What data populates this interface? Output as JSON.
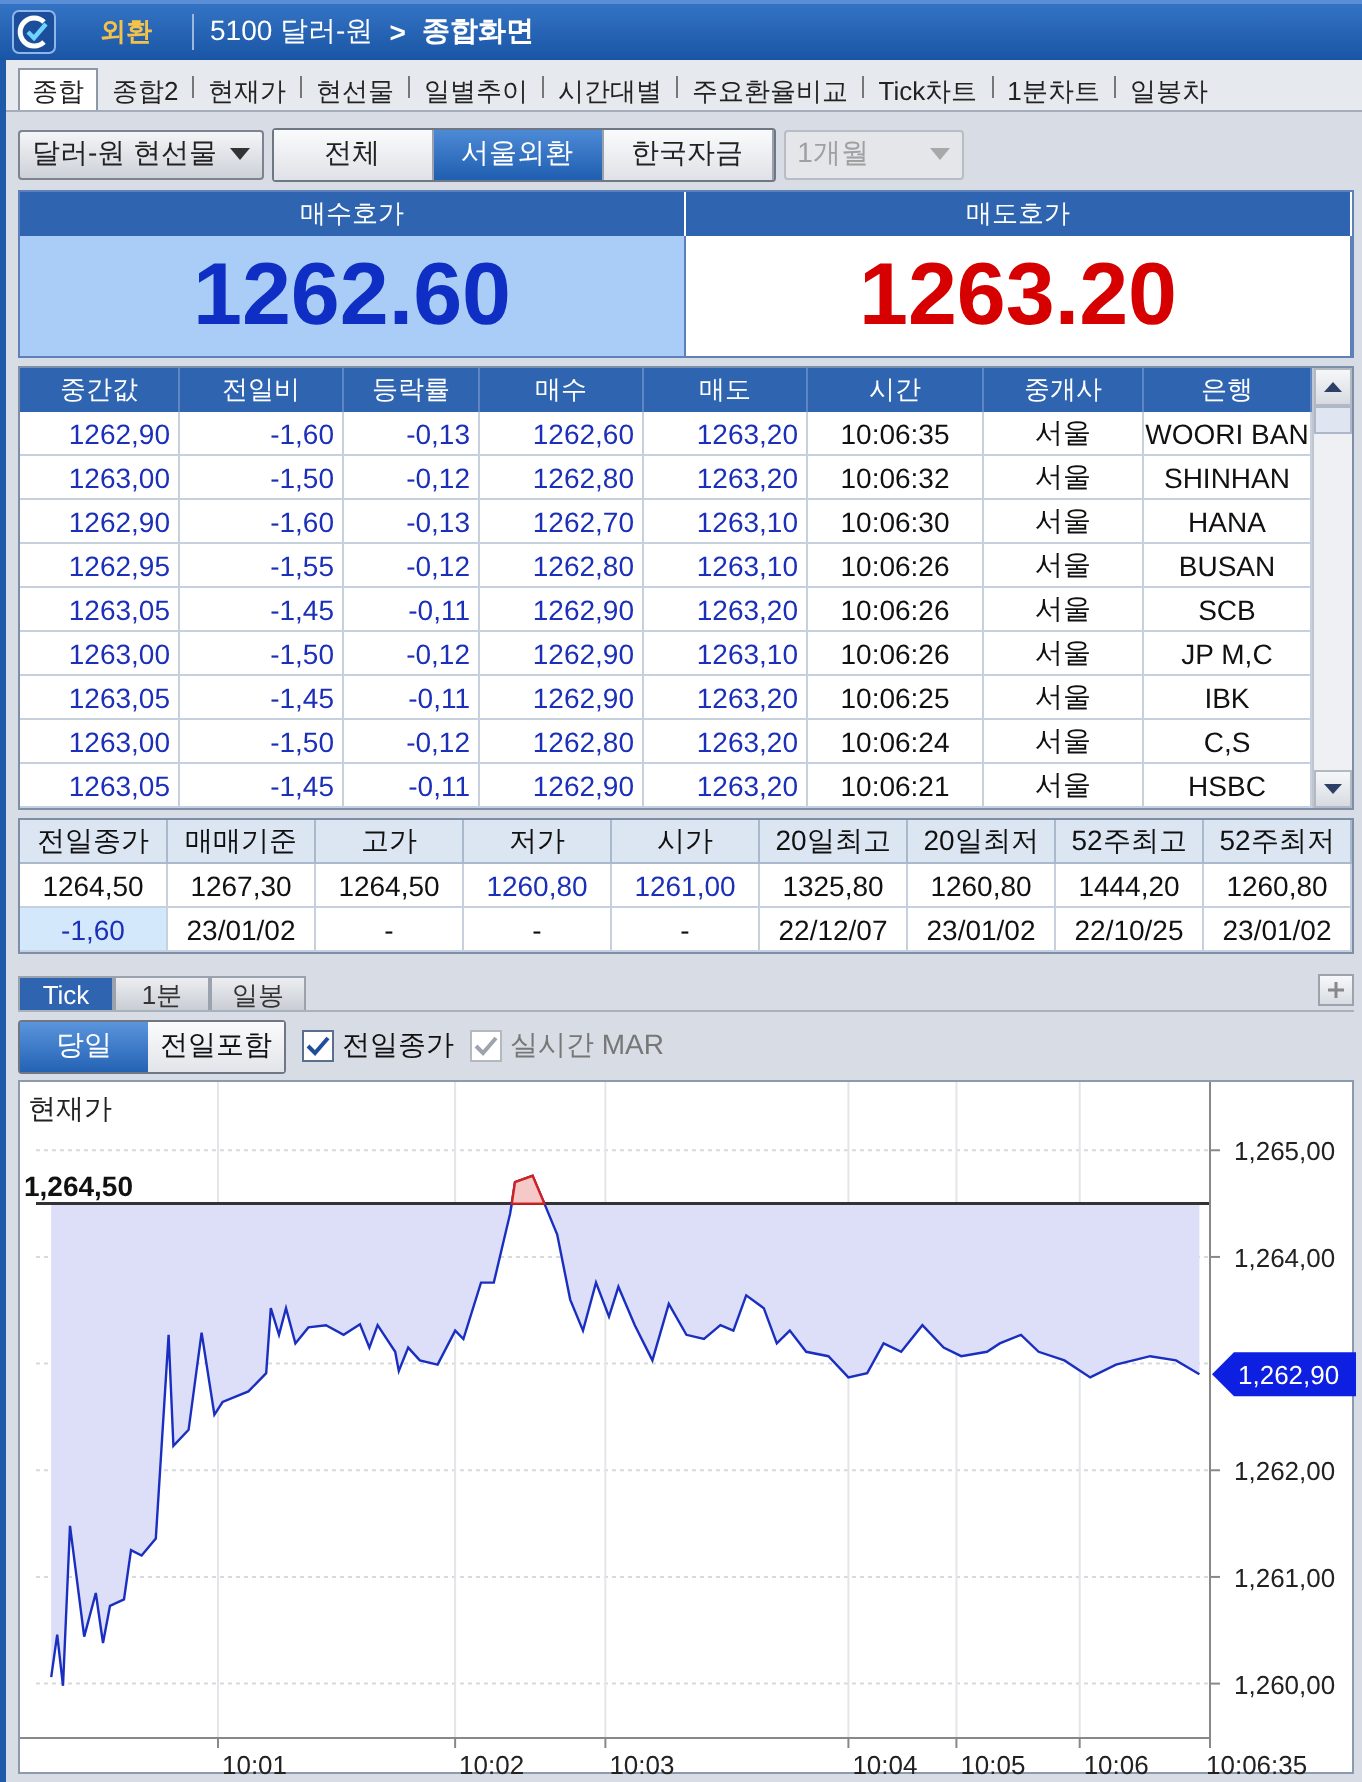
{
  "title_bar": {
    "badge": "외환",
    "screen_code": "5100 달러-원",
    "separator": ">",
    "title": "종합화면"
  },
  "tabs": [
    {
      "label": "종합",
      "selected": true
    },
    {
      "label": "종합2",
      "selected": false
    },
    {
      "label": "현재가",
      "selected": false
    },
    {
      "label": "현선물",
      "selected": false
    },
    {
      "label": "일별추이",
      "selected": false
    },
    {
      "label": "시간대별",
      "selected": false
    },
    {
      "label": "주요환율비교",
      "selected": false
    },
    {
      "label": "Tick차트",
      "selected": false
    },
    {
      "label": "1분차트",
      "selected": false
    },
    {
      "label": "일봉차",
      "selected": false
    }
  ],
  "toolbar": {
    "instrument": "달러-원 현선물",
    "segments": [
      {
        "label": "전체",
        "selected": false
      },
      {
        "label": "서울외환",
        "selected": true
      },
      {
        "label": "한국자금",
        "selected": false
      }
    ],
    "period": {
      "value": "1개월",
      "disabled": true
    }
  },
  "quotes": [
    {
      "label": "매수호가",
      "value": "1262.60"
    },
    {
      "label": "매도호가",
      "value": "1263.20"
    }
  ],
  "trades": {
    "columns": [
      {
        "label": "중간값",
        "kind": "num"
      },
      {
        "label": "전일비",
        "kind": "num"
      },
      {
        "label": "등락률",
        "kind": "num"
      },
      {
        "label": "매수",
        "kind": "num"
      },
      {
        "label": "매도",
        "kind": "num"
      },
      {
        "label": "시간",
        "kind": "text"
      },
      {
        "label": "중개사",
        "kind": "text"
      },
      {
        "label": "은행",
        "kind": "text"
      }
    ],
    "rows": [
      [
        "1262,90",
        "-1,60",
        "-0,13",
        "1262,60",
        "1263,20",
        "10:06:35",
        "서울",
        "WOORI BAN"
      ],
      [
        "1263,00",
        "-1,50",
        "-0,12",
        "1262,80",
        "1263,20",
        "10:06:32",
        "서울",
        "SHINHAN"
      ],
      [
        "1262,90",
        "-1,60",
        "-0,13",
        "1262,70",
        "1263,10",
        "10:06:30",
        "서울",
        "HANA"
      ],
      [
        "1262,95",
        "-1,55",
        "-0,12",
        "1262,80",
        "1263,10",
        "10:06:26",
        "서울",
        "BUSAN"
      ],
      [
        "1263,05",
        "-1,45",
        "-0,11",
        "1262,90",
        "1263,20",
        "10:06:26",
        "서울",
        "SCB"
      ],
      [
        "1263,00",
        "-1,50",
        "-0,12",
        "1262,90",
        "1263,10",
        "10:06:26",
        "서울",
        "JP M,C"
      ],
      [
        "1263,05",
        "-1,45",
        "-0,11",
        "1262,90",
        "1263,20",
        "10:06:25",
        "서울",
        "IBK"
      ],
      [
        "1263,00",
        "-1,50",
        "-0,12",
        "1262,80",
        "1263,20",
        "10:06:24",
        "서울",
        "C,S"
      ],
      [
        "1263,05",
        "-1,45",
        "-0,11",
        "1262,90",
        "1263,20",
        "10:06:21",
        "서울",
        "HSBC"
      ]
    ]
  },
  "summary": [
    {
      "label": "전일종가",
      "cells": [
        {
          "text": "1264,50",
          "color": "#111111",
          "selected": false
        },
        {
          "text": "-1,60",
          "color": "#1b2fb8",
          "selected": true
        }
      ]
    },
    {
      "label": "매매기준",
      "cells": [
        {
          "text": "1267,30",
          "color": "#111111",
          "selected": false
        },
        {
          "text": "23/01/02",
          "color": "#111111",
          "selected": false
        }
      ]
    },
    {
      "label": "고가",
      "cells": [
        {
          "text": "1264,50",
          "color": "#111111",
          "selected": false
        },
        {
          "text": "-",
          "color": "#111111",
          "selected": false
        }
      ]
    },
    {
      "label": "저가",
      "cells": [
        {
          "text": "1260,80",
          "color": "#1b2fb8",
          "selected": false
        },
        {
          "text": "-",
          "color": "#111111",
          "selected": false
        }
      ]
    },
    {
      "label": "시가",
      "cells": [
        {
          "text": "1261,00",
          "color": "#1b2fb8",
          "selected": false
        },
        {
          "text": "-",
          "color": "#111111",
          "selected": false
        }
      ]
    },
    {
      "label": "20일최고",
      "cells": [
        {
          "text": "1325,80",
          "color": "#111111",
          "selected": false
        },
        {
          "text": "22/12/07",
          "color": "#111111",
          "selected": false
        }
      ]
    },
    {
      "label": "20일최저",
      "cells": [
        {
          "text": "1260,80",
          "color": "#111111",
          "selected": false
        },
        {
          "text": "23/01/02",
          "color": "#111111",
          "selected": false
        }
      ]
    },
    {
      "label": "52주최고",
      "cells": [
        {
          "text": "1444,20",
          "color": "#111111",
          "selected": false
        },
        {
          "text": "22/10/25",
          "color": "#111111",
          "selected": false
        }
      ]
    },
    {
      "label": "52주최저",
      "cells": [
        {
          "text": "1260,80",
          "color": "#111111",
          "selected": false
        },
        {
          "text": "23/01/02",
          "color": "#111111",
          "selected": false
        }
      ]
    }
  ],
  "chart_tabs": [
    {
      "label": "Tick",
      "selected": true
    },
    {
      "label": "1분",
      "selected": false
    },
    {
      "label": "일봉",
      "selected": false
    }
  ],
  "chart_options": {
    "range": [
      {
        "label": "당일",
        "selected": true
      },
      {
        "label": "전일포함",
        "selected": false
      }
    ],
    "checkboxes": [
      {
        "label": "전일종가",
        "checked": true,
        "disabled": false
      },
      {
        "label": "실시간 MAR",
        "checked": true,
        "disabled": true
      }
    ]
  },
  "chart": {
    "title": "현재가",
    "x_labels": [
      "10:01",
      "10:02",
      "10:03",
      "10:04",
      "10:05",
      "10:06",
      "10:06:35"
    ],
    "y_labels": [
      "1,265,00",
      "1,264,00",
      "1,262,00",
      "1,261,00",
      "1,260,00"
    ],
    "reference_label": "1,264,50",
    "last_price": "1,262,90"
  }
}
